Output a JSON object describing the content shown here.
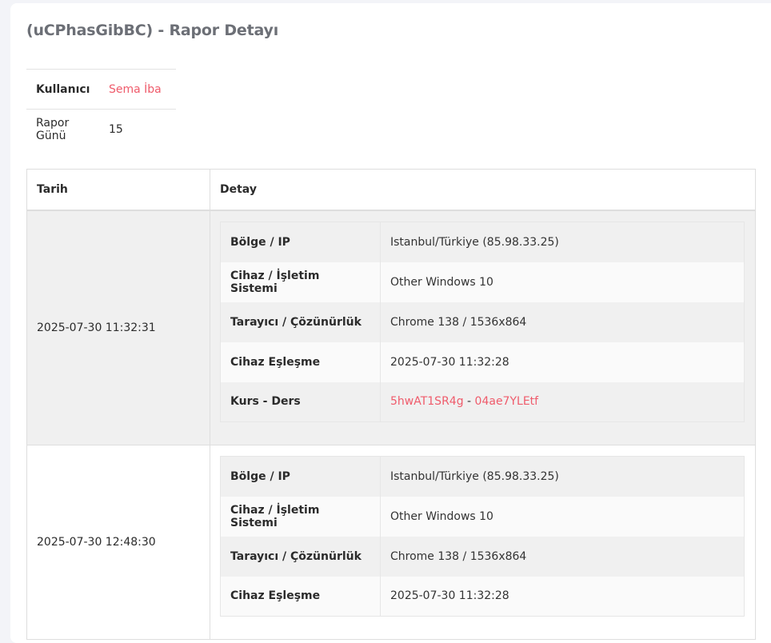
{
  "page": {
    "title": "(uCPhasGibBC) - Rapor Detayı"
  },
  "summary": {
    "user_label": "Kullanıcı",
    "user_value": "Sema İba",
    "days_label": "Rapor Günü",
    "days_value": "15"
  },
  "report": {
    "headers": {
      "date": "Tarih",
      "detail": "Detay"
    },
    "labels": {
      "region": "Bölge / IP",
      "device": "Cihaz / İşletim Sistemi",
      "browser": "Tarayıcı / Çözünürlük",
      "pairing": "Cihaz Eşleşme",
      "course": "Kurs - Ders"
    },
    "rows": [
      {
        "date": "2025-07-30 11:32:31",
        "region": "Istanbul/Türkiye (85.98.33.25)",
        "device": "Other Windows 10",
        "browser": "Chrome 138 / 1536x864",
        "pairing": "2025-07-30 11:32:28",
        "course_code": "5hwAT1SR4g",
        "separator": " - ",
        "lesson_code": "04ae7YLEtf"
      },
      {
        "date": "2025-07-30 12:48:30",
        "region": "Istanbul/Türkiye (85.98.33.25)",
        "device": "Other Windows 10",
        "browser": "Chrome 138 / 1536x864",
        "pairing": "2025-07-30 11:32:28"
      }
    ]
  },
  "colors": {
    "link": "#ef5b6b",
    "title": "#6c6f76",
    "shade": "#f0f0f0"
  }
}
